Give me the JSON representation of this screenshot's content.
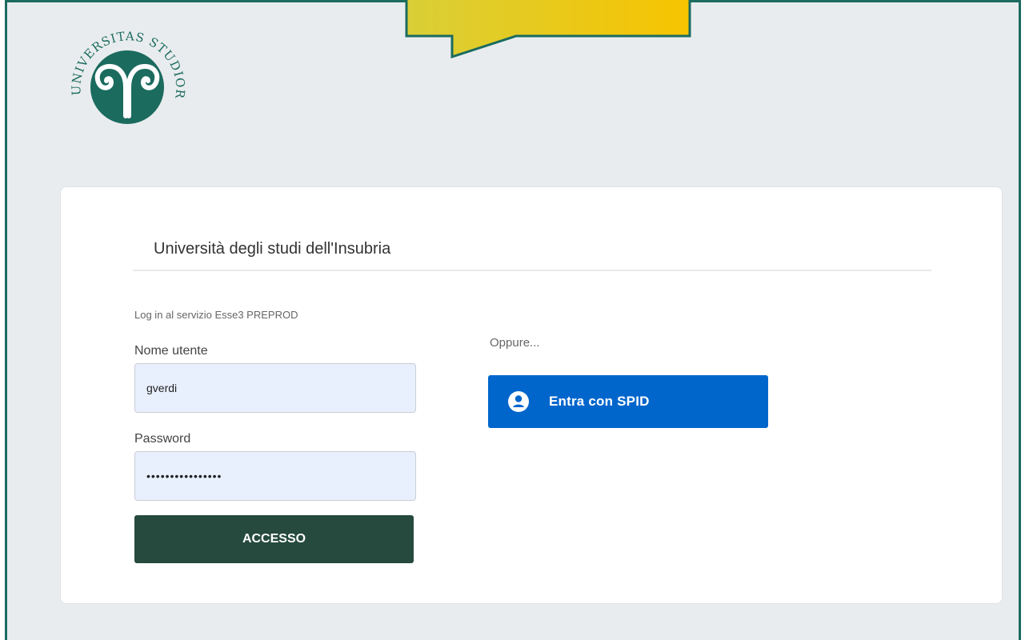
{
  "logo": {
    "icon": "university-seal-icon",
    "text": "UNIVERSITAS STUDIORUM INSUBRIAE",
    "color": "#1b6b5f"
  },
  "card": {
    "title": "Università degli studi dell'Insubria"
  },
  "login": {
    "service_text": "Log in al servizio Esse3 PREPROD",
    "username_label": "Nome utente",
    "username_value": "gverdi",
    "password_label": "Password",
    "password_value": "••••••••••••••••",
    "submit_label": "ACCESSO"
  },
  "alt_login": {
    "or_text": "Oppure...",
    "spid_label": "Entra con SPID",
    "spid_icon": "user-circle-icon",
    "spid_color": "#0066cc"
  },
  "colors": {
    "frame_border": "#1b6b5f",
    "background": "#e9ecee",
    "submit_button": "#264a3d",
    "callout": "#f3c600"
  }
}
